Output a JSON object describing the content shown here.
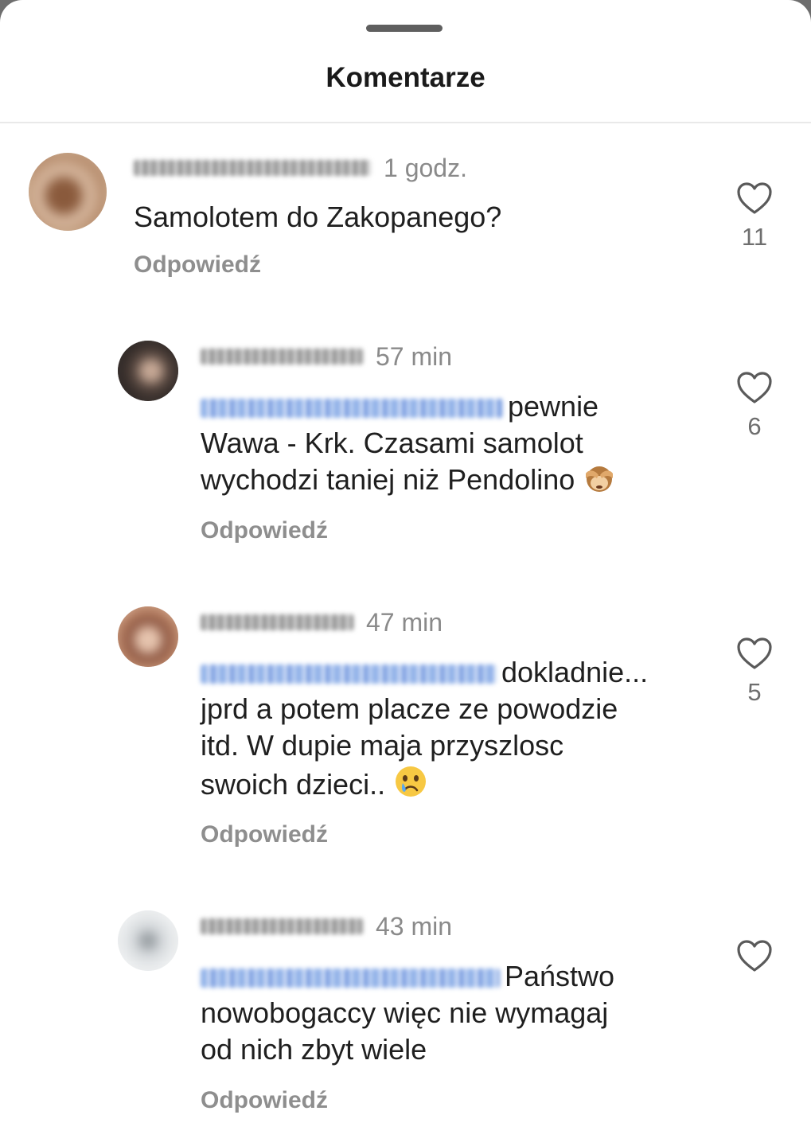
{
  "sheet": {
    "title": "Komentarze"
  },
  "comments": [
    {
      "time": "1 godz.",
      "lines": [
        "Samolotem do Zakopanego?"
      ],
      "reply": "Odpowiedź",
      "likes": "11"
    },
    {
      "time": "57 min",
      "first_line_text": "pewnie",
      "lines": [
        "Wawa - Krk. Czasami samolot",
        "wychodzi taniej niż Pendolino"
      ],
      "emoji": "see-no-evil-monkey",
      "reply": "Odpowiedź",
      "likes": "6"
    },
    {
      "time": "47 min",
      "first_line_text": "dokladnie...",
      "lines": [
        "jprd a potem placze ze powodzie",
        "itd. W dupie maja przyszlosc",
        "swoich dzieci.."
      ],
      "emoji": "crying-face",
      "reply": "Odpowiedź",
      "likes": "5"
    },
    {
      "time": "43 min",
      "first_line_text": "Państwo",
      "lines": [
        "nowobogaccy więc nie wymagaj",
        "od nich zbyt wiele"
      ],
      "reply": "Odpowiedź",
      "likes": ""
    }
  ],
  "colors": {
    "accent_mention": "#3d6fd6",
    "meta_grey": "#8a8a8a",
    "text": "#1f1f1f"
  }
}
